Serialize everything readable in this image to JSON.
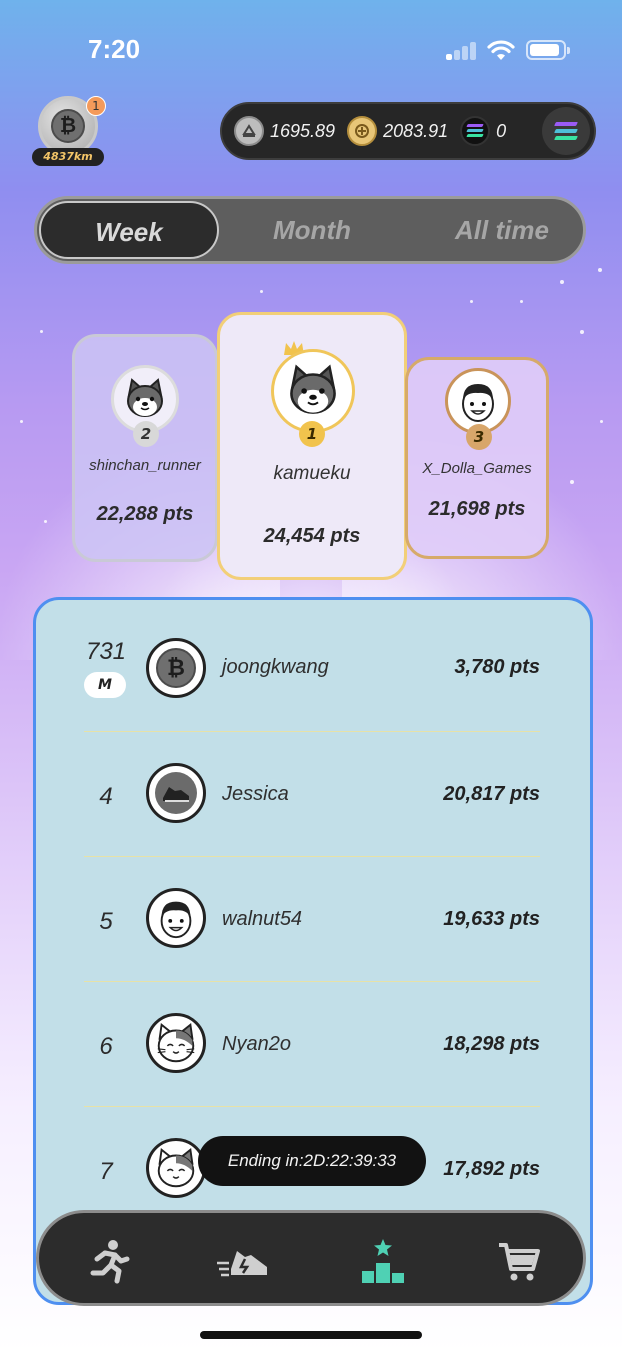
{
  "status_bar": {
    "time": "7:20"
  },
  "profile": {
    "notification_count": "1",
    "distance": "4837km"
  },
  "wallet": {
    "energy_value": "1695.89",
    "gold_value": "2083.91",
    "sol_value": "0"
  },
  "tabs": [
    {
      "label": "Week",
      "active": true
    },
    {
      "label": "Month",
      "active": false
    },
    {
      "label": "All time",
      "active": false
    }
  ],
  "podium": {
    "first": {
      "rank": "1",
      "name": "kamueku",
      "points": "24,454 pts"
    },
    "second": {
      "rank": "2",
      "name": "shinchan_runner",
      "points": "22,288 pts"
    },
    "third": {
      "rank": "3",
      "name": "X_Dolla_Games",
      "points": "21,698 pts"
    }
  },
  "leaderboard": {
    "me": {
      "rank": "731",
      "badge": "M",
      "name": "joongkwang",
      "points": "3,780 pts"
    },
    "rows": [
      {
        "rank": "4",
        "name": "Jessica",
        "points": "20,817 pts"
      },
      {
        "rank": "5",
        "name": "walnut54",
        "points": "19,633 pts"
      },
      {
        "rank": "6",
        "name": "Nyan2o",
        "points": "18,298 pts"
      },
      {
        "rank": "7",
        "name": "",
        "points": "17,892 pts"
      }
    ]
  },
  "ending": {
    "text": "Ending in:2D:22:39:33"
  },
  "bottom_nav": [
    {
      "icon": "running-man-icon",
      "active": false
    },
    {
      "icon": "sneaker-icon",
      "active": false
    },
    {
      "icon": "podium-icon",
      "active": true
    },
    {
      "icon": "cart-icon",
      "active": false
    }
  ],
  "colors": {
    "accent_active_nav": "#4fd1b4",
    "gold_border": "#f2cf78",
    "list_background": "#c2dfe8"
  }
}
